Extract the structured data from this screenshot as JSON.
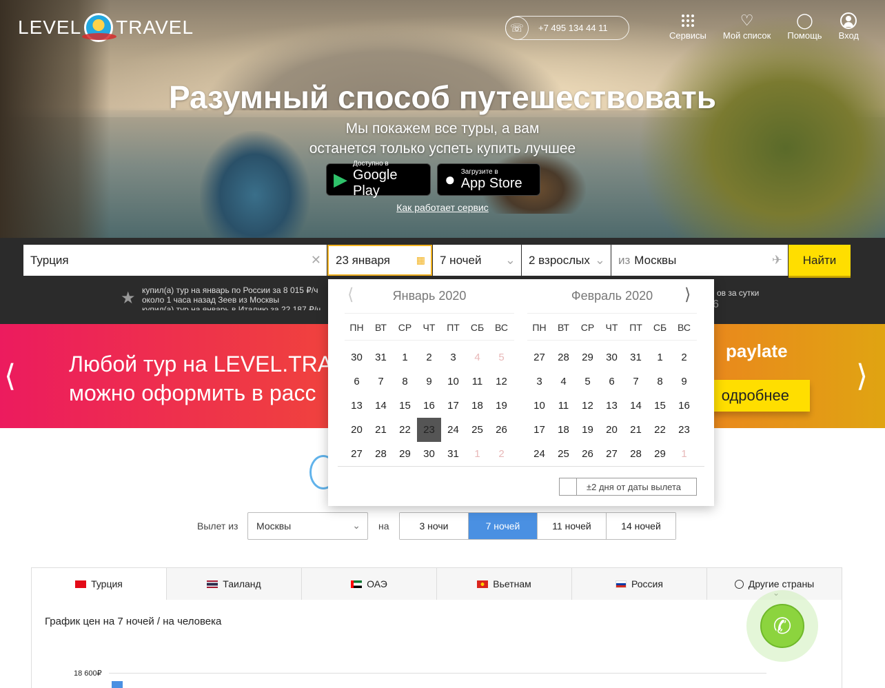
{
  "header": {
    "logo_left": "LEVEL",
    "logo_right": "TRAVEL",
    "phone": "+7 495 134 44 11",
    "nav": [
      {
        "label": "Сервисы",
        "icon": "grid-icon"
      },
      {
        "label": "Мой список",
        "icon": "heart-icon"
      },
      {
        "label": "Помощь",
        "icon": "lightbulb-icon"
      },
      {
        "label": "Вход",
        "icon": "user-icon"
      }
    ]
  },
  "hero": {
    "title": "Разумный способ путешествовать",
    "subtitle_line1": "Мы покажем все туры, а вам",
    "subtitle_line2": "останется только успеть купить лучшее",
    "google_small": "Доступно в",
    "google_big": "Google Play",
    "apple_small": "Загрузите в",
    "apple_big": "App Store",
    "how_link": "Как работает сервис"
  },
  "search": {
    "destination": "Турция",
    "date": "23 января",
    "nights": "7 ночей",
    "travelers": "2 взрослых",
    "from_prefix": "из",
    "from_city": "Москвы",
    "find_label": "Найти"
  },
  "ticker": {
    "line1": "купил(а) тур на январь по России за 8 015 ₽/ч",
    "line2": "около 1 часа назад Зеев из Москвы",
    "line3": "купил(а) тур на январь в Италию за 22 187 ₽/ч",
    "right_text": "ов за сутки",
    "right_num": "6"
  },
  "banner": {
    "line1": "Любой тур на LEVEL.TRA",
    "line2": "можно оформить в расс",
    "paylate": "paylate",
    "more": "одробнее"
  },
  "calendar": {
    "dow": [
      "ПН",
      "ВТ",
      "СР",
      "ЧТ",
      "ПТ",
      "СБ",
      "ВС"
    ],
    "months": [
      {
        "title": "Январь 2020",
        "days": [
          "30",
          "31",
          "1",
          "2",
          "3",
          "4",
          "5",
          "6",
          "7",
          "8",
          "9",
          "10",
          "11",
          "12",
          "13",
          "14",
          "15",
          "16",
          "17",
          "18",
          "19",
          "20",
          "21",
          "22",
          "23",
          "24",
          "25",
          "26",
          "27",
          "28",
          "29",
          "30",
          "31",
          "1",
          "2"
        ]
      },
      {
        "title": "Февраль 2020",
        "days": [
          "27",
          "28",
          "29",
          "30",
          "31",
          "1",
          "2",
          "3",
          "4",
          "5",
          "6",
          "7",
          "8",
          "9",
          "10",
          "11",
          "12",
          "13",
          "14",
          "15",
          "16",
          "17",
          "18",
          "19",
          "20",
          "21",
          "22",
          "23",
          "24",
          "25",
          "26",
          "27",
          "28",
          "29",
          "1"
        ]
      }
    ],
    "flex_label": "±2 дня от даты вылета"
  },
  "filters": {
    "from_label": "Вылет из",
    "city": "Москвы",
    "on_label": "на",
    "nights_options": [
      "3 ночи",
      "7 ночей",
      "11 ночей",
      "14 ночей"
    ],
    "active_nights": "7 ночей"
  },
  "tabs": [
    {
      "label": "Турция",
      "flag": "turkey"
    },
    {
      "label": "Таиланд",
      "flag": "thailand"
    },
    {
      "label": "ОАЭ",
      "flag": "uae"
    },
    {
      "label": "Вьетнам",
      "flag": "vietnam"
    },
    {
      "label": "Россия",
      "flag": "russia"
    },
    {
      "label": "Другие страны",
      "flag": "globe"
    }
  ],
  "price_chart": {
    "title": "График цен на 7 ночей / на человека",
    "ytick": "18 600₽"
  },
  "colors": {
    "accent_yellow": "#ffde00",
    "active_blue": "#4a90e2",
    "weekend_red": "#c0392b"
  }
}
